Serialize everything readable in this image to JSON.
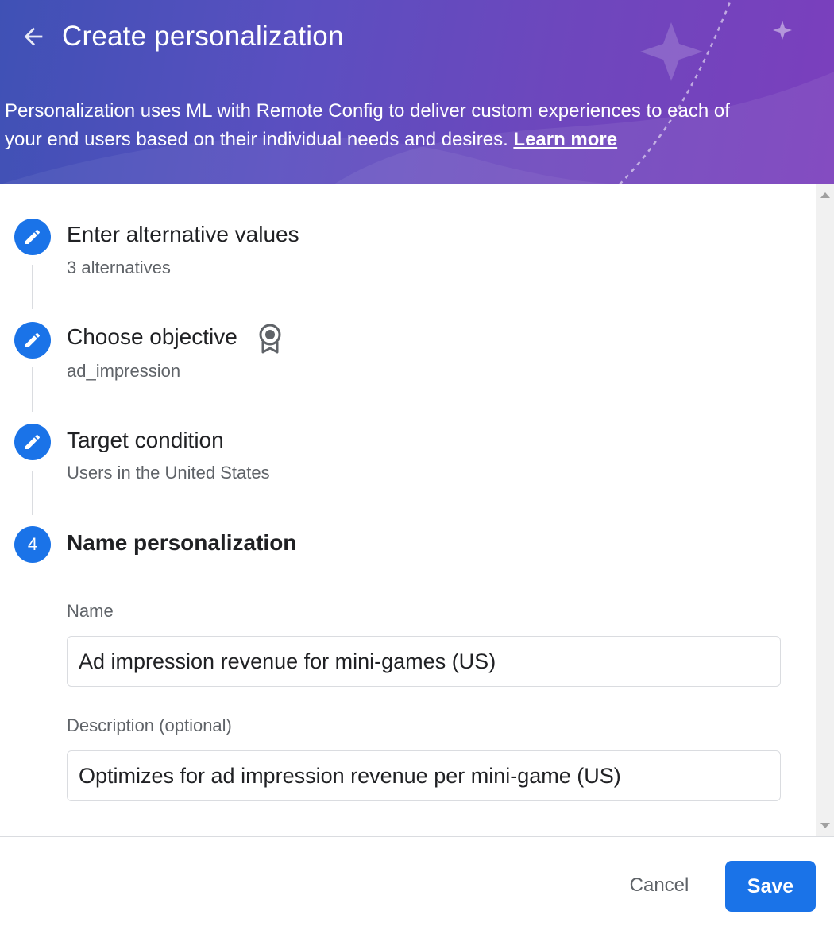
{
  "header": {
    "title": "Create personalization",
    "intro_text": "Personalization uses ML with Remote Config to deliver custom experiences to each of your end users based on their individual needs and desires. ",
    "learn_more": "Learn more",
    "back_icon": "arrow-back-icon"
  },
  "steps": [
    {
      "title": "Enter alternative values",
      "subtitle": "3 alternatives",
      "state": "completed",
      "icon": "pencil-icon"
    },
    {
      "title": "Choose objective",
      "subtitle": "ad_impression",
      "state": "completed",
      "icon": "pencil-icon",
      "badge_icon": "award-ribbon-icon"
    },
    {
      "title": "Target condition",
      "subtitle": "Users in the United States",
      "state": "completed",
      "icon": "pencil-icon"
    },
    {
      "title": "Name personalization",
      "number": "4",
      "state": "active"
    }
  ],
  "form": {
    "name_label": "Name",
    "name_value": "Ad impression revenue for mini-games (US)",
    "description_label": "Description (optional)",
    "description_value": "Optimizes for ad impression revenue per mini-game (US)"
  },
  "footer": {
    "cancel_label": "Cancel",
    "save_label": "Save"
  },
  "colors": {
    "primary": "#1a73e8",
    "header_gradient_start": "#3f51b5",
    "header_gradient_end": "#7b3fbd"
  }
}
